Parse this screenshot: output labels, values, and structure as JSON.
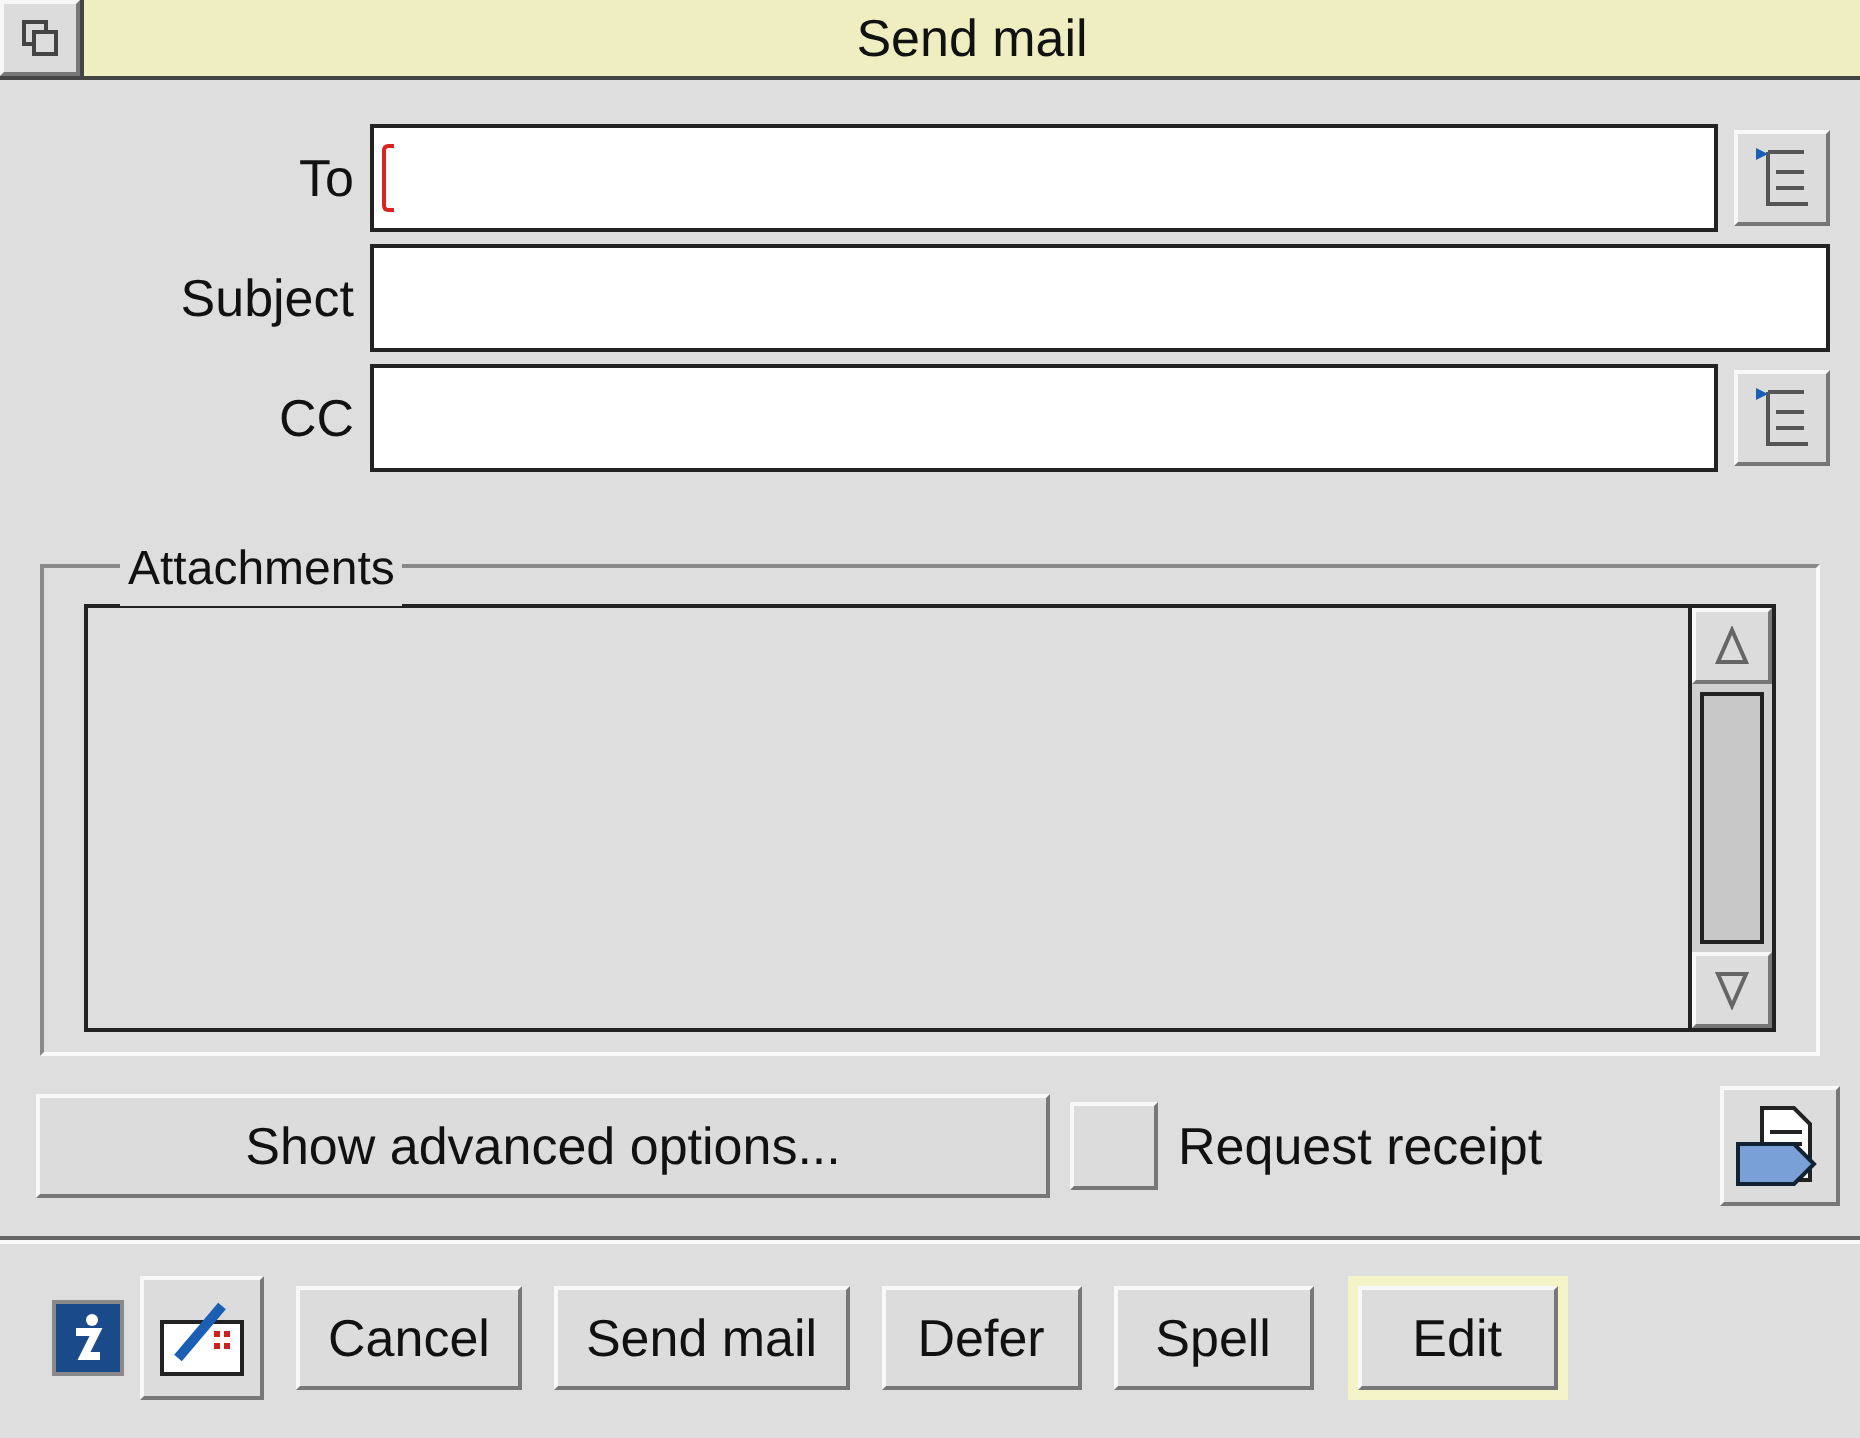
{
  "window": {
    "title": "Send mail"
  },
  "fields": [
    {
      "label": "To",
      "focused": true,
      "picker": true
    },
    {
      "label": "Subject",
      "focused": false,
      "picker": false
    },
    {
      "label": "CC",
      "focused": false,
      "picker": true
    }
  ],
  "attachments": {
    "label": "Attachments"
  },
  "options": {
    "advanced_button": "Show advanced options...",
    "receipt": {
      "label": "Request receipt",
      "checked": false
    }
  },
  "buttons": [
    {
      "label": "Cancel",
      "default": false
    },
    {
      "label": "Send mail",
      "default": false
    },
    {
      "label": "Defer",
      "default": false
    },
    {
      "label": "Spell",
      "default": false
    },
    {
      "label": "Edit",
      "default": true
    }
  ]
}
